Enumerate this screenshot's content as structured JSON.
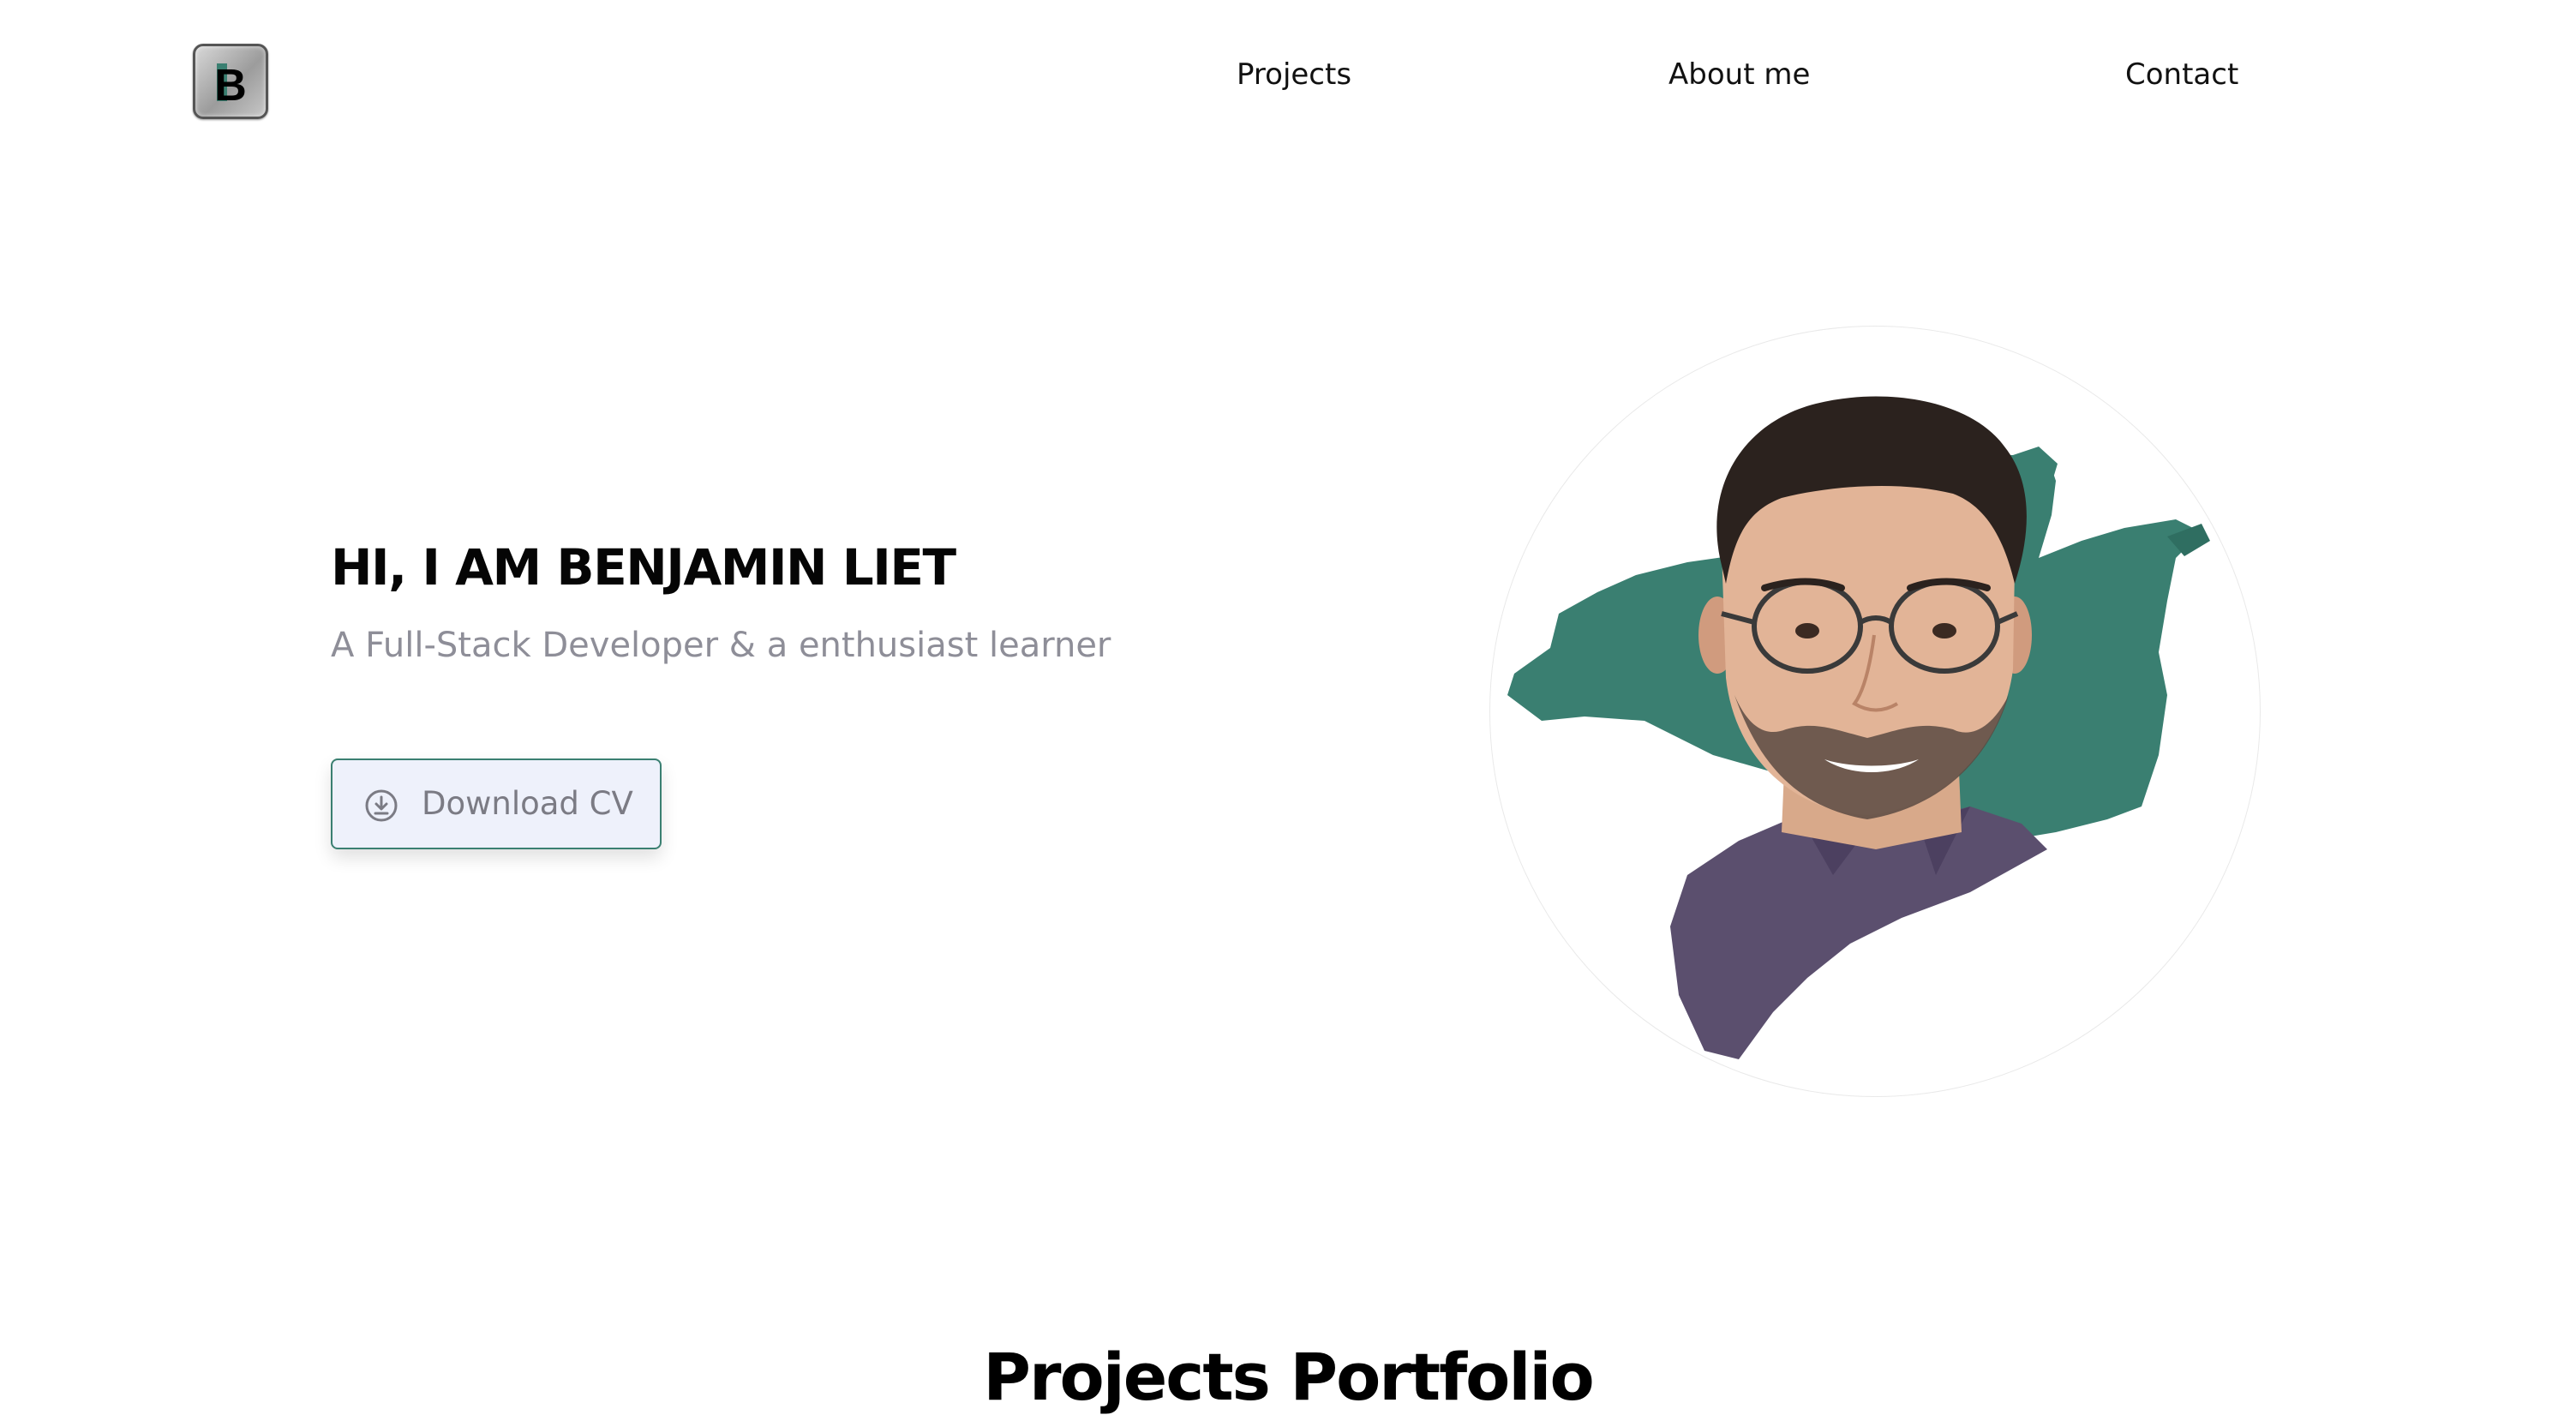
{
  "header": {
    "logo_letter": "B",
    "nav": [
      {
        "label": "Projects"
      },
      {
        "label": "About me"
      },
      {
        "label": "Contact"
      }
    ]
  },
  "hero": {
    "title": "HI, I AM BENJAMIN LIET",
    "subtitle": "A Full-Stack Developer & a enthusiast learner",
    "download_button": {
      "label": "Download CV",
      "icon": "download-circle-icon"
    },
    "portrait_icon": "profile-photo"
  },
  "sections": {
    "projects_title": "Projects Portfolio"
  },
  "colors": {
    "accent_green": "#3a7f71",
    "button_bg": "#eef1fb",
    "subtitle_gray": "#8e8e98",
    "shirt_purple": "#5b4f6e"
  }
}
